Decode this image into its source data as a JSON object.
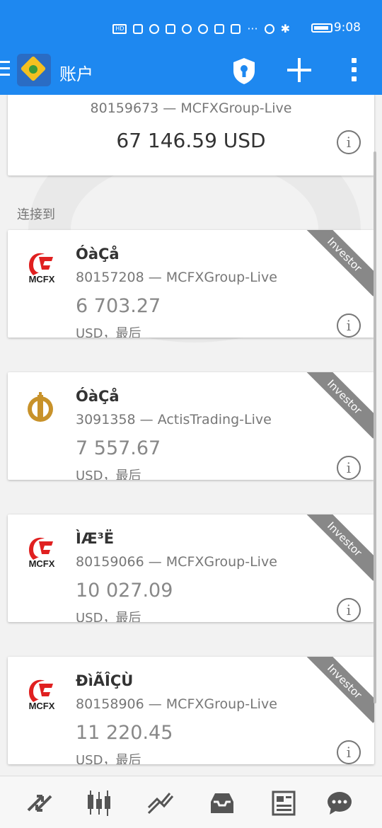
{
  "status_bar": {
    "time": "9:08",
    "icons": [
      "hd-icon",
      "signal-icon",
      "wifi-icon",
      "vpn-shield-icon",
      "qq-icon",
      "app-icon",
      "app-icon",
      "baidu-icon",
      "more-icon",
      "alarm-icon",
      "bluetooth-icon",
      "battery-icon"
    ]
  },
  "header": {
    "title": "账户"
  },
  "main_account": {
    "account_line": "80159673 — MCFXGroup-Live",
    "balance": "67 146.59 USD"
  },
  "section_label": "连接到",
  "accounts": [
    {
      "name": "ÓàÇå",
      "account_line": "80157208 — MCFXGroup-Live",
      "balance": "6 703.27",
      "currency_line": "USD，最后",
      "badge": "Investor",
      "logo_text": "MCFX",
      "logo": "mcfx"
    },
    {
      "name": "ÓàÇå",
      "account_line": "3091358 — ActisTrading-Live",
      "balance": "7 557.67",
      "currency_line": "USD，最后",
      "badge": "Investor",
      "logo": "actis"
    },
    {
      "name": "ÌÆ³Ë",
      "account_line": "80159066 — MCFXGroup-Live",
      "balance": "10 027.09",
      "currency_line": "USD，最后",
      "badge": "Investor",
      "logo_text": "MCFX",
      "logo": "mcfx"
    },
    {
      "name": "ÐìÃÎÇÙ",
      "account_line": "80158906 — MCFXGroup-Live",
      "balance": "11 220.45",
      "currency_line": "USD，最后",
      "badge": "Investor",
      "logo_text": "MCFX",
      "logo": "mcfx"
    }
  ],
  "bottom_nav": [
    "quotes-icon",
    "chart-icon",
    "trade-icon",
    "history-icon",
    "news-icon",
    "chat-icon"
  ],
  "colors": {
    "header": "#1e88f0",
    "badge": "#888888",
    "mcfx_red": "#e02020",
    "actis_gold": "#c8922a"
  }
}
